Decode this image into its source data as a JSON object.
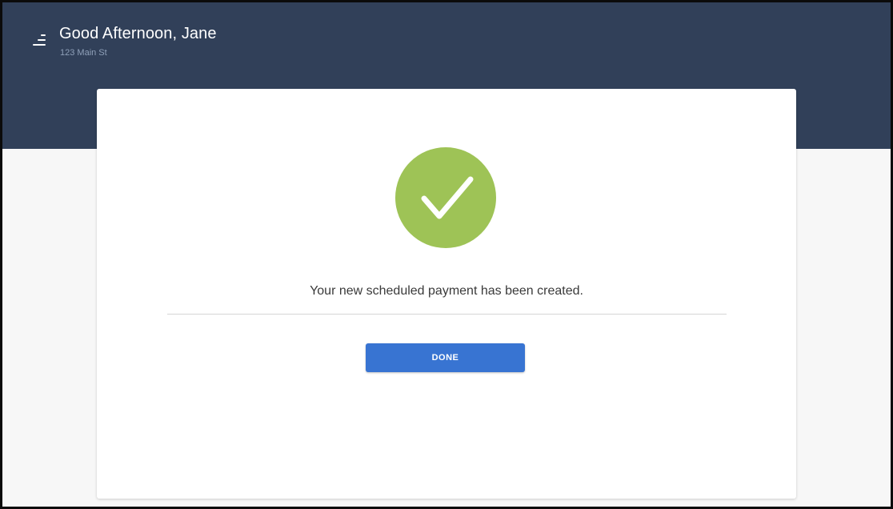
{
  "header": {
    "greeting": "Good Afternoon, Jane",
    "address": "123 Main St",
    "menu_icon": "menu-icon",
    "background_color": "#314059"
  },
  "confirmation": {
    "icon": "checkmark-circle-icon",
    "icon_color": "#9ec356",
    "message": "Your new scheduled payment has been created.",
    "done_label": "DONE",
    "button_color": "#3874d2"
  }
}
